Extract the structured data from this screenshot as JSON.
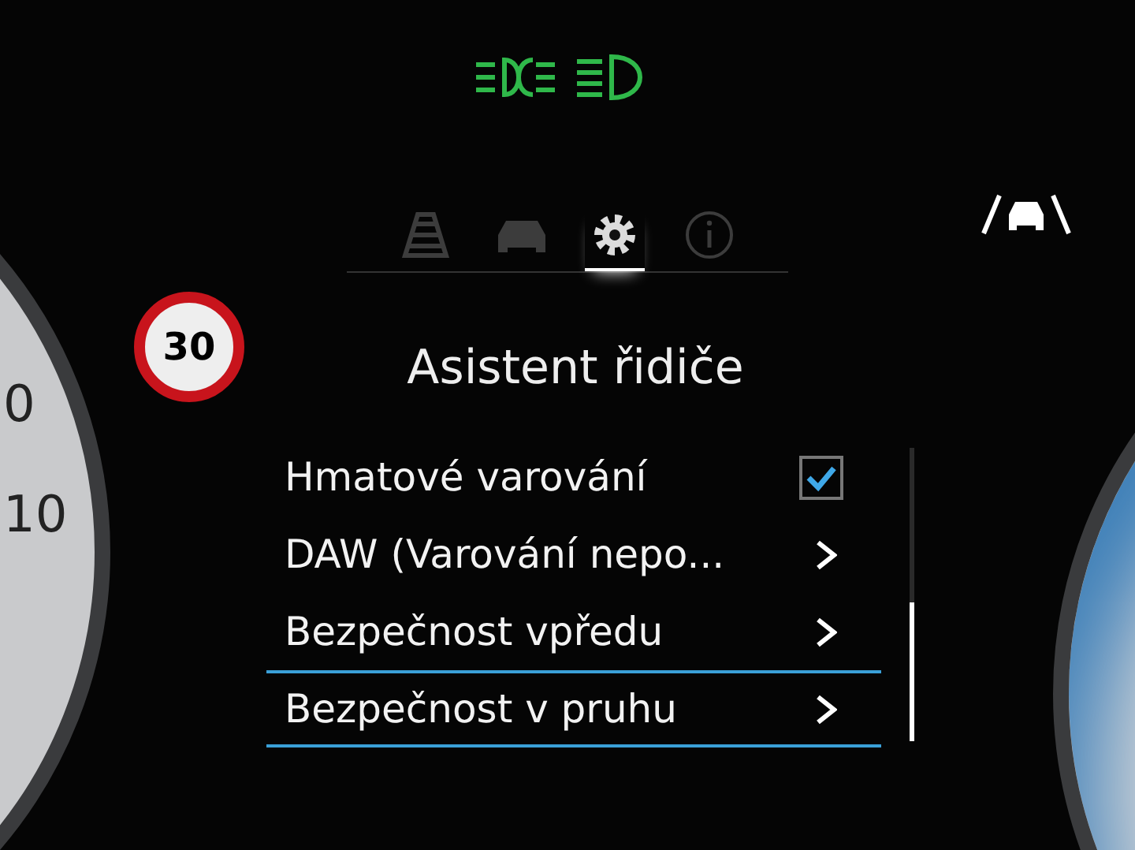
{
  "tabs": [
    {
      "kind": "lane",
      "selected": false
    },
    {
      "kind": "car",
      "selected": false
    },
    {
      "kind": "settings",
      "selected": true
    },
    {
      "kind": "info",
      "selected": false
    }
  ],
  "speed_limit_sign": {
    "value": "30"
  },
  "left_gauge": {
    "labels": [
      "0",
      "10"
    ]
  },
  "title": "Asistent řidiče",
  "menu": [
    {
      "label": "Hmatové varování",
      "kind": "checkbox",
      "checked": true,
      "selected": false
    },
    {
      "label": "DAW (Varování nepo...",
      "kind": "submenu",
      "selected": false
    },
    {
      "label": "Bezpečnost vpředu",
      "kind": "submenu",
      "selected": false
    },
    {
      "label": "Bezpečnost v pruhu",
      "kind": "submenu",
      "selected": true
    }
  ]
}
